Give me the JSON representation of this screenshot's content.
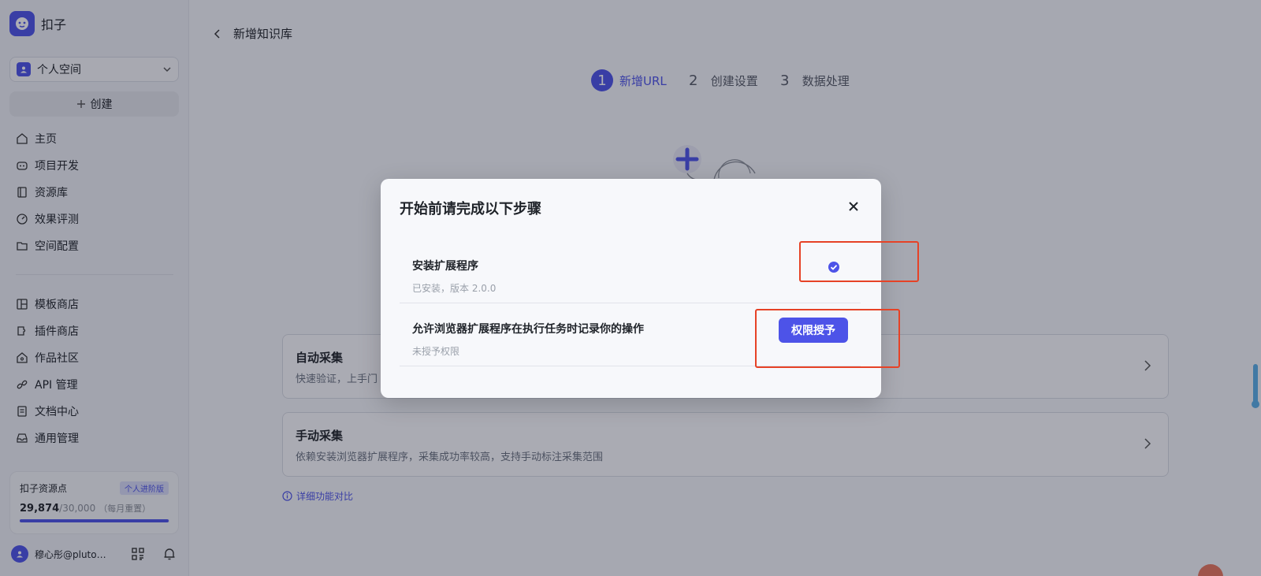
{
  "app": {
    "name": "扣子"
  },
  "sidebar": {
    "space": "个人空间",
    "create_label": "创建",
    "nav_primary": [
      {
        "id": "home",
        "label": "主页"
      },
      {
        "id": "project",
        "label": "项目开发"
      },
      {
        "id": "library",
        "label": "资源库"
      },
      {
        "id": "eval",
        "label": "效果评测"
      },
      {
        "id": "space-config",
        "label": "空间配置"
      }
    ],
    "nav_secondary": [
      {
        "id": "template",
        "label": "模板商店"
      },
      {
        "id": "plugin",
        "label": "插件商店"
      },
      {
        "id": "community",
        "label": "作品社区"
      },
      {
        "id": "api",
        "label": "API 管理"
      },
      {
        "id": "docs",
        "label": "文档中心"
      },
      {
        "id": "general",
        "label": "通用管理"
      }
    ],
    "points": {
      "title": "扣子资源点",
      "badge": "个人进阶版",
      "value": "29,874",
      "max": "/30,000",
      "reset": "（每月重置）",
      "fraction": 0.9958
    },
    "user": {
      "name": "穆心彤@pluto…"
    }
  },
  "main": {
    "page_title": "新增知识库",
    "steps": [
      {
        "num": "1",
        "label": "新增URL",
        "active": true
      },
      {
        "num": "2",
        "label": "创建设置",
        "active": false
      },
      {
        "num": "3",
        "label": "数据处理",
        "active": false
      }
    ],
    "cards": [
      {
        "title": "自动采集",
        "desc": "快速验证，上手门"
      },
      {
        "title": "手动采集",
        "desc": "依赖安装浏览器扩展程序，采集成功率较高，支持手动标注采集范围"
      }
    ],
    "compare_link": "详细功能对比"
  },
  "modal": {
    "title": "开始前请完成以下步骤",
    "steps": [
      {
        "title": "安装扩展程序",
        "sub": "已安装，版本 2.0.0",
        "done": true
      },
      {
        "title": "允许浏览器扩展程序在执行任务时记录你的操作",
        "sub": "未授予权限",
        "button": "权限授予"
      }
    ]
  },
  "colors": {
    "accent": "#4d53e8",
    "annotation": "#e64226"
  }
}
